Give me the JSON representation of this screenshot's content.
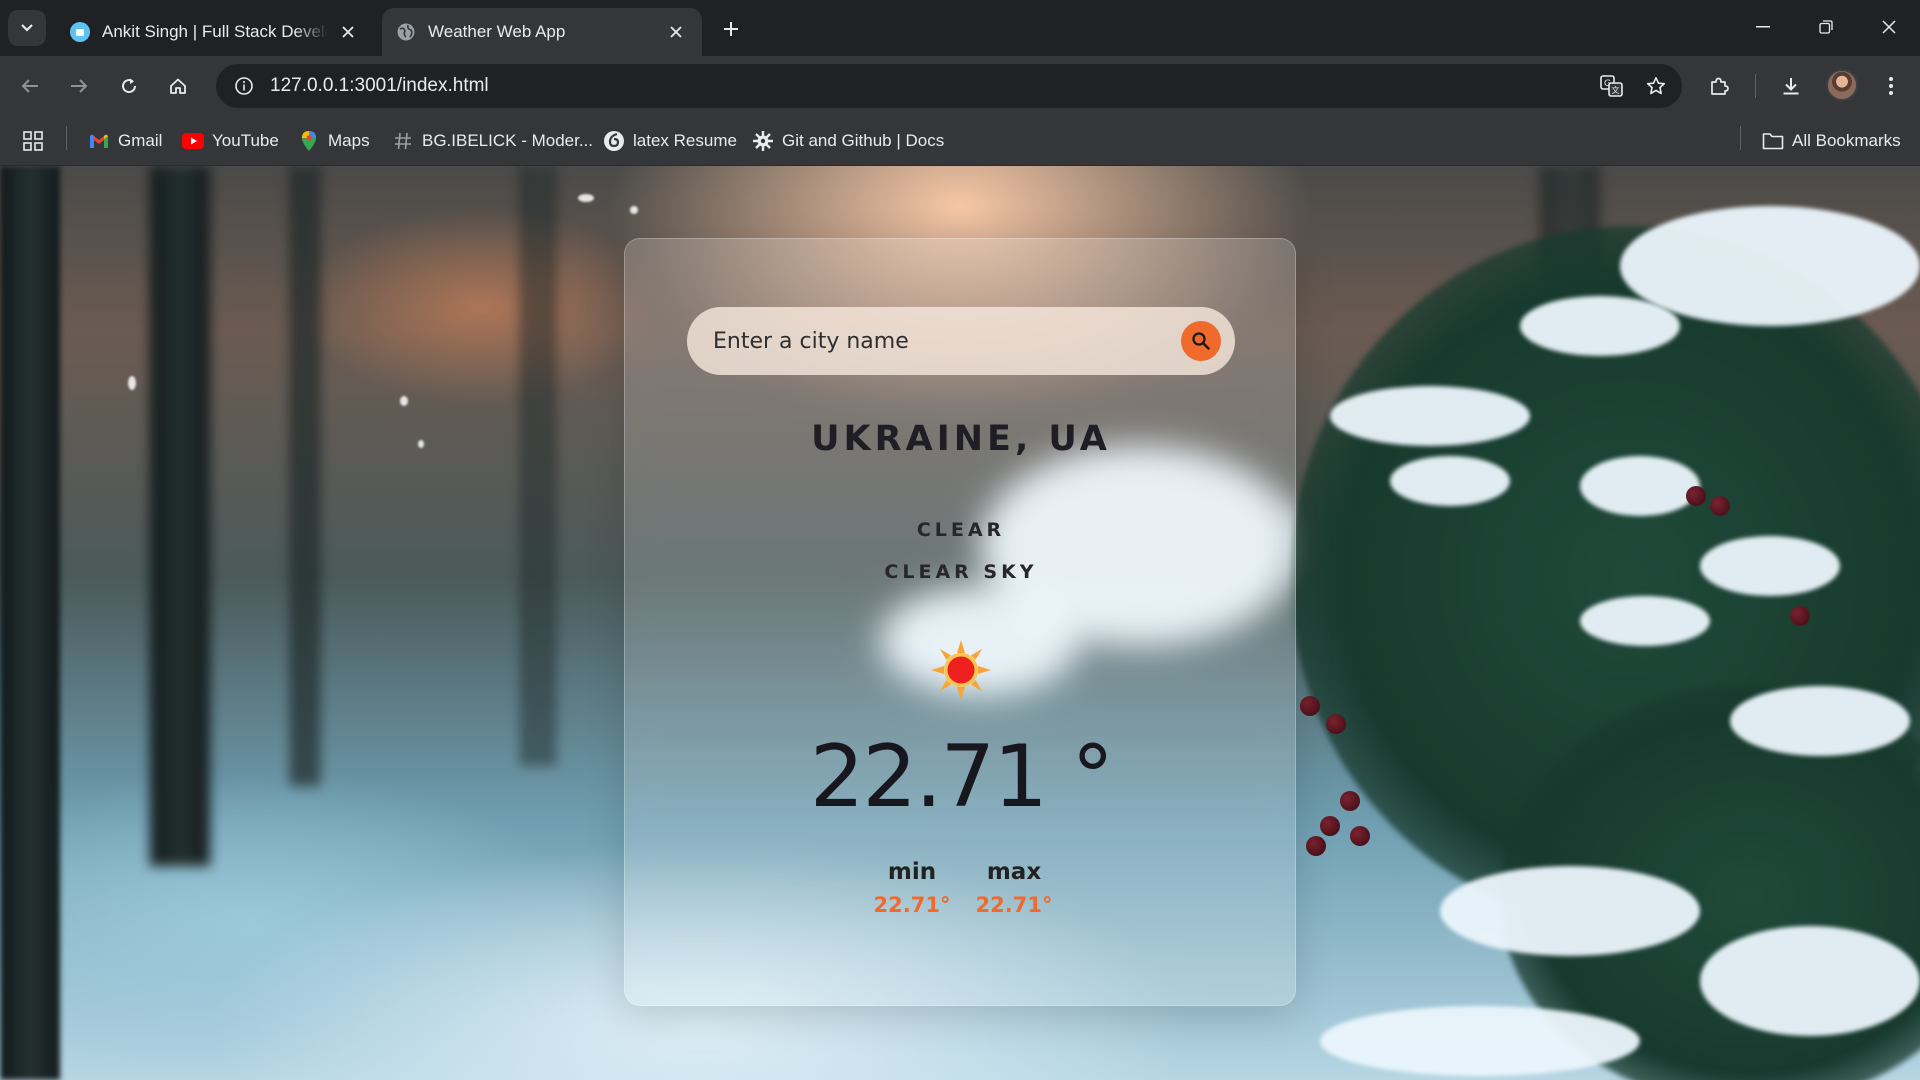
{
  "browser": {
    "tabs": [
      {
        "title": "Ankit Singh | Full Stack Develop",
        "active": false,
        "favicon": "portfolio-favicon-icon"
      },
      {
        "title": "Weather Web App",
        "active": true,
        "favicon": "globe-icon"
      }
    ],
    "url": "127.0.0.1:3001/index.html",
    "bookmarks": [
      {
        "label": "Gmail",
        "icon": "gmail-icon"
      },
      {
        "label": "YouTube",
        "icon": "youtube-icon"
      },
      {
        "label": "Maps",
        "icon": "maps-icon"
      },
      {
        "label": "BG.IBELICK - Moder...",
        "icon": "hash-icon"
      },
      {
        "label": "latex Resume",
        "icon": "overleaf-icon"
      },
      {
        "label": "Git and Github | Docs",
        "icon": "gear-icon"
      }
    ],
    "all_bookmarks_label": "All Bookmarks"
  },
  "weather": {
    "search_placeholder": "Enter a city name",
    "city": "UKRAINE, UA",
    "condition": "CLEAR",
    "description": "CLEAR SKY",
    "temperature": "22.71 °",
    "min_label": "min",
    "min_value": "22.71°",
    "max_label": "max",
    "max_value": "22.71°",
    "accent_color": "#f06a2c"
  }
}
